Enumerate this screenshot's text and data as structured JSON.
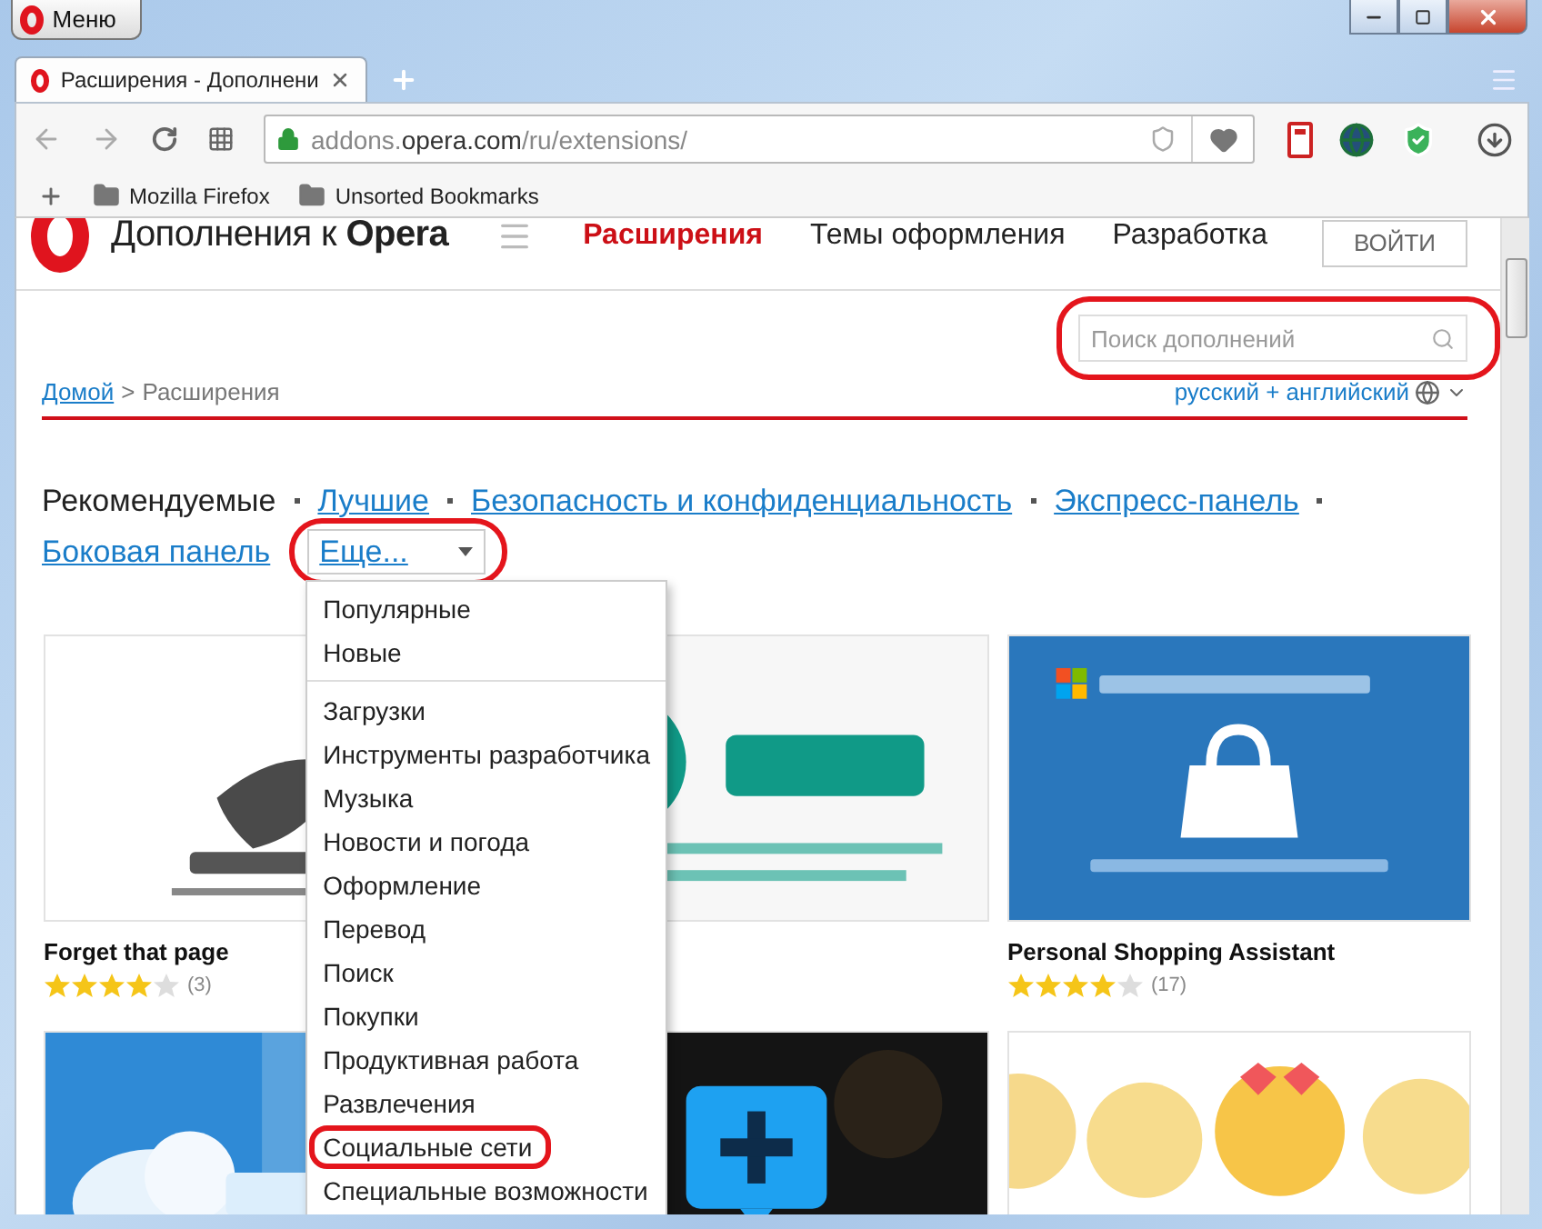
{
  "window": {
    "menu_button": "Меню"
  },
  "tabs": [
    {
      "title": "Расширения - Дополнени",
      "selected": true
    }
  ],
  "address_bar": {
    "url_prefix": "addons.",
    "url_domain": "opera.com",
    "url_path": "/ru/extensions/"
  },
  "bookmarks": [
    "Mozilla Firefox",
    "Unsorted Bookmarks"
  ],
  "site": {
    "logo_text": "Дополнения к **Opera**",
    "login_button": "ВОЙТИ",
    "nav": [
      {
        "label": "Расширения",
        "selected": true
      },
      {
        "label": "Темы оформления",
        "selected": false
      },
      {
        "label": "Разработка",
        "selected": false
      }
    ]
  },
  "search": {
    "placeholder": "Поиск дополнений",
    "highlighted": true
  },
  "breadcrumb": {
    "home": "Домой",
    "separator": ">",
    "current": "Расширения"
  },
  "language": "русский + английский",
  "categories": [
    {
      "label": "Рекомендуемые",
      "selected": true
    },
    {
      "label": "Лучшие",
      "selected": false
    },
    {
      "label": "Безопасность и конфиденциальность",
      "selected": false
    },
    {
      "label": "Экспресс-панель",
      "selected": false
    },
    {
      "label": "Боковая панель",
      "selected": false
    }
  ],
  "more": {
    "label": "Еще...",
    "highlighted": true,
    "expanded": true
  },
  "menu": {
    "groups": [
      [
        {
          "label": "Популярные",
          "highlighted": false
        },
        {
          "label": "Новые",
          "highlighted": false
        }
      ],
      [
        {
          "label": "Загрузки",
          "highlighted": false
        },
        {
          "label": "Инструменты разработчика",
          "highlighted": false
        },
        {
          "label": "Музыка",
          "highlighted": false
        },
        {
          "label": "Новости и погода",
          "highlighted": false
        },
        {
          "label": "Оформление",
          "highlighted": false
        },
        {
          "label": "Перевод",
          "highlighted": false
        },
        {
          "label": "Поиск",
          "highlighted": false
        },
        {
          "label": "Покупки",
          "highlighted": false
        },
        {
          "label": "Продуктивная работа",
          "highlighted": false
        },
        {
          "label": "Развлечения",
          "highlighted": false
        },
        {
          "label": "Социальные сети",
          "highlighted": true
        },
        {
          "label": "Специальные возможности",
          "highlighted": false
        }
      ]
    ]
  },
  "cards": [
    {
      "kind": "picture",
      "title": "Forget that page",
      "stars": 4,
      "count": "(3)"
    },
    {
      "kind": "picture"
    },
    {
      "kind": "picture",
      "title": "Personal Shopping Assistant",
      "stars": 4,
      "count": "(17)"
    },
    {
      "kind": "picture"
    },
    {
      "kind": "picture"
    },
    {
      "kind": "picture"
    }
  ]
}
